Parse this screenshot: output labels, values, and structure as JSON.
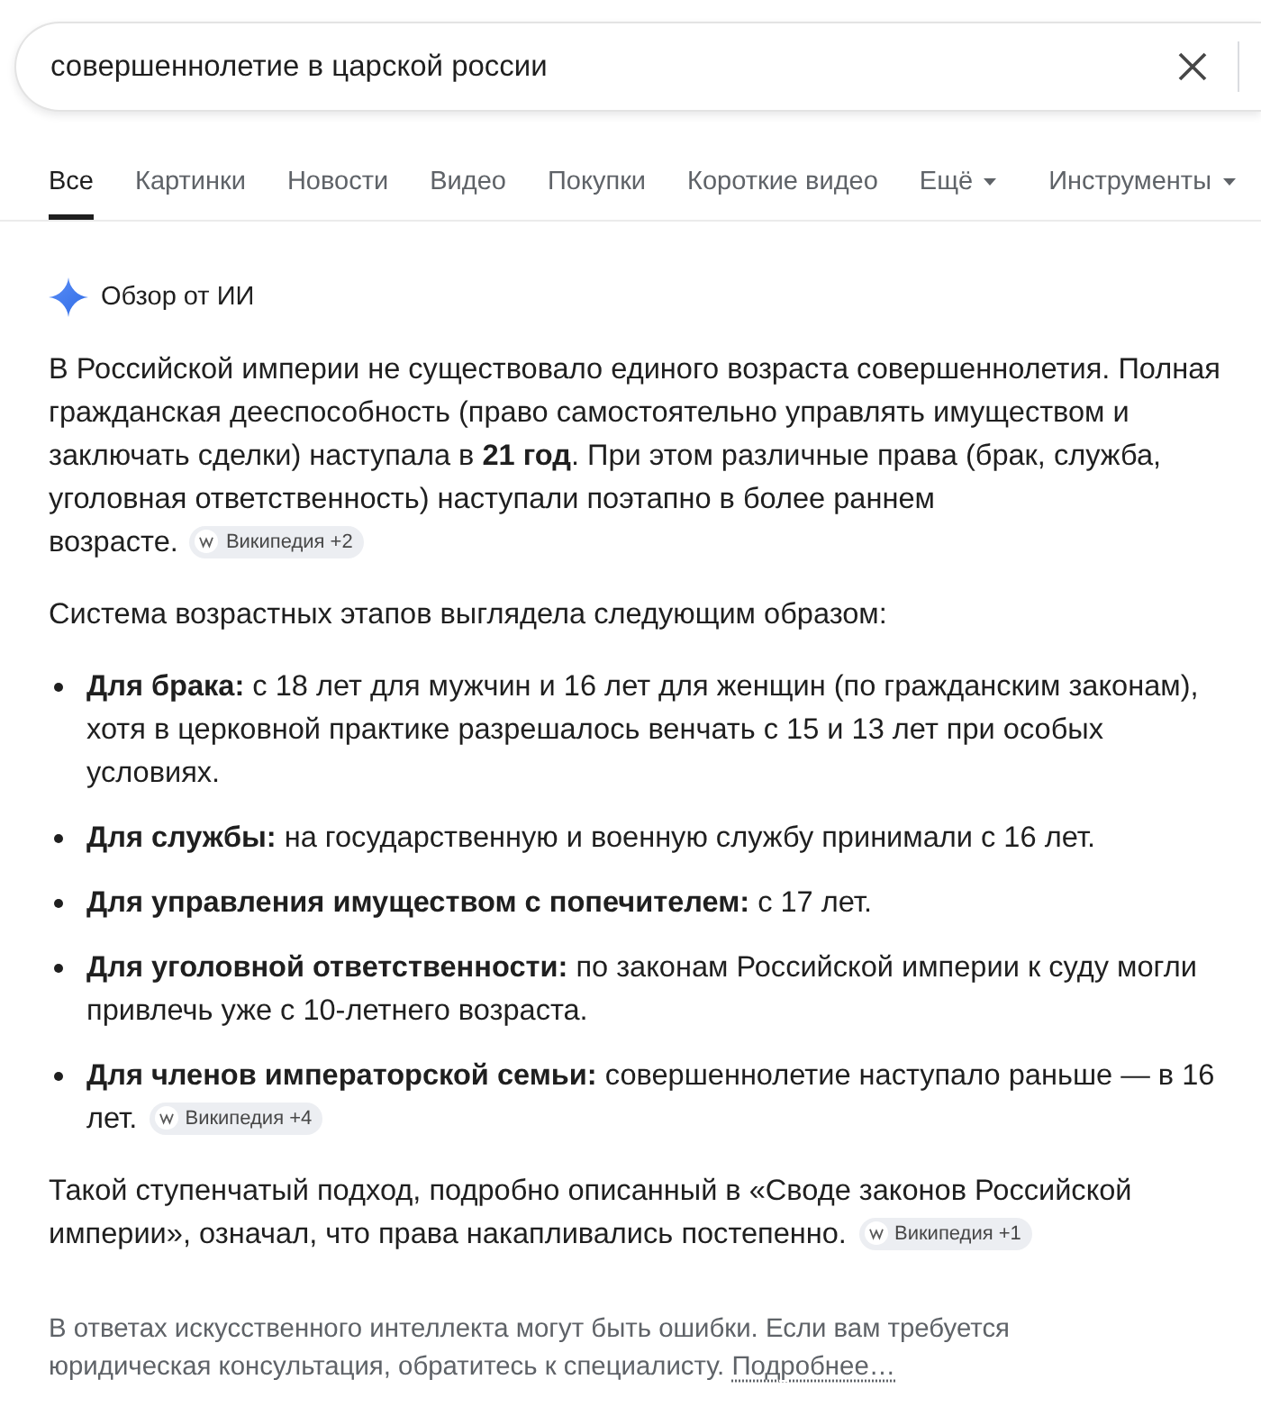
{
  "search": {
    "query": "совершеннолетие в царской россии"
  },
  "tabs": [
    {
      "label": "Все",
      "selected": true,
      "kind": "tab"
    },
    {
      "label": "Картинки",
      "selected": false,
      "kind": "tab"
    },
    {
      "label": "Новости",
      "selected": false,
      "kind": "tab"
    },
    {
      "label": "Видео",
      "selected": false,
      "kind": "tab"
    },
    {
      "label": "Покупки",
      "selected": false,
      "kind": "tab"
    },
    {
      "label": "Короткие видео",
      "selected": false,
      "kind": "tab"
    },
    {
      "label": "Ещё",
      "selected": false,
      "kind": "menu"
    },
    {
      "label": "Инструменты",
      "selected": false,
      "kind": "menu"
    }
  ],
  "ai_overview": {
    "title": "Обзор от ИИ",
    "blocks": [
      {
        "kind": "paragraph",
        "text": "В Российской империи не существовало единого возраста совершеннолетия. Полная гражданская дееспособность (право самостоятельно управлять имуществом и заключать сделки) наступала в **21 год**. При этом различные права (брак, служба, уголовная ответственность) наступали поэтапно в более раннем возрасте.",
        "source": "Википедия +2"
      },
      {
        "kind": "paragraph",
        "text": "Система возрастных этапов выглядела следующим образом:"
      },
      {
        "kind": "list",
        "items": [
          {
            "text": "**Для брака:** с 18 лет для мужчин и 16 лет для женщин (по гражданским законам), хотя в церковной практике разрешалось венчать с 15 и 13 лет при особых условиях."
          },
          {
            "text": "**Для службы:** на государственную и военную службу принимали с 16 лет."
          },
          {
            "text": "**Для управления имуществом с попечителем:** с 17 лет."
          },
          {
            "text": "**Для уголовной ответственности:** по законам Российской империи к суду могли привлечь уже с 10-летнего возраста."
          },
          {
            "text": "**Для членов императорской семьи:** совершеннолетие наступало раньше — в 16 лет.",
            "source": "Википедия +4"
          }
        ]
      },
      {
        "kind": "paragraph",
        "text": "Такой ступенчатый подход, подробно описанный в «Своде законов Российской империи», означал, что права накапливались постепенно.",
        "source": "Википедия +1"
      }
    ]
  },
  "disclaimer": {
    "text": "В ответах искусственного интеллекта могут быть ошибки. Если вам требуется юридическая консультация, обратитесь к специалисту.",
    "link": "Подробнее…"
  }
}
